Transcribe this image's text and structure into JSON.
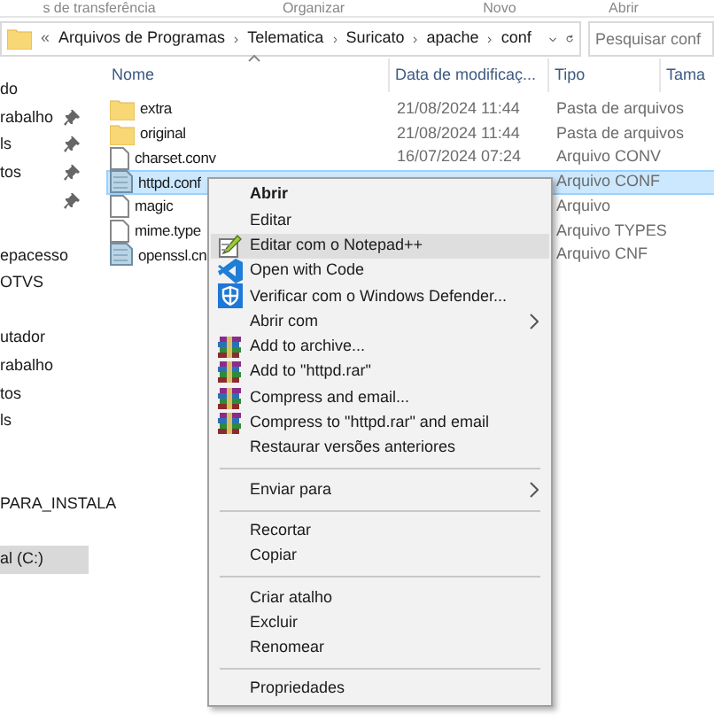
{
  "ribbon_groups": [
    "s de transferência",
    "Organizar",
    "Novo",
    "Abrir"
  ],
  "address_bar": {
    "overflow": "«",
    "crumbs": [
      "Arquivos de Programas",
      "Telematica",
      "Suricato",
      "apache",
      "conf"
    ]
  },
  "search": {
    "placeholder": "Pesquisar conf"
  },
  "sidebar": {
    "items": [
      {
        "label": "do",
        "pinned": false,
        "selected": false
      },
      {
        "label": "rabalho",
        "pinned": true,
        "selected": false
      },
      {
        "label": "ls",
        "pinned": true,
        "selected": false
      },
      {
        "label": "tos",
        "pinned": true,
        "selected": false
      },
      {
        "pinned": true
      },
      {
        "pinned": false
      },
      {
        "label": "epacesso",
        "pinned": false,
        "selected": false
      },
      {
        "label": "OTVS",
        "pinned": false,
        "selected": false
      },
      {
        "pinned": false
      },
      {
        "label": "utador",
        "pinned": false,
        "selected": false
      },
      {
        "label": "rabalho",
        "pinned": false,
        "selected": false
      },
      {
        "label": "tos",
        "pinned": false,
        "selected": false
      },
      {
        "label": "ls",
        "pinned": false,
        "selected": false
      },
      {
        "pinned": false
      },
      {
        "pinned": false
      },
      {
        "label": "PARA_INSTALA",
        "pinned": false,
        "selected": false
      },
      {
        "pinned": false
      },
      {
        "label": "al (C:)",
        "pinned": false,
        "selected": true
      }
    ]
  },
  "table": {
    "columns": [
      "Nome",
      "Data de modificaç...",
      "Tipo",
      "Tama"
    ],
    "rows": [
      {
        "kind": "folder",
        "name": "extra",
        "date": "21/08/2024 11:44",
        "type": "Pasta de arquivos",
        "selected": false
      },
      {
        "kind": "folder",
        "name": "original",
        "date": "21/08/2024 11:44",
        "type": "Pasta de arquivos",
        "selected": false
      },
      {
        "kind": "file",
        "name": "charset.conv",
        "date": "16/07/2024 07:24",
        "type": "Arquivo CONV",
        "selected": false
      },
      {
        "kind": "conf",
        "name": "httpd.conf",
        "type": "Arquivo CONF",
        "selected": true
      },
      {
        "kind": "file",
        "name": "magic",
        "type": "Arquivo",
        "selected": false
      },
      {
        "kind": "file",
        "name": "mime.type",
        "type": "Arquivo TYPES",
        "selected": false
      },
      {
        "kind": "conf",
        "name": "openssl.cn",
        "type": "Arquivo CNF",
        "selected": false
      }
    ]
  },
  "context_menu": [
    {
      "kind": "plain",
      "label": "Abrir",
      "default": true,
      "selected": false,
      "submenu": false
    },
    {
      "kind": "plain",
      "label": "Editar",
      "default": false,
      "selected": false,
      "submenu": false
    },
    {
      "kind": "notepad",
      "label": "Editar com o Notepad++",
      "default": false,
      "selected": true,
      "submenu": false
    },
    {
      "kind": "code",
      "label": "Open with Code",
      "default": false,
      "selected": false,
      "submenu": false
    },
    {
      "kind": "shield",
      "label": "Verificar com o Windows Defender...",
      "default": false,
      "selected": false,
      "submenu": false
    },
    {
      "kind": "plain",
      "label": "Abrir com",
      "default": false,
      "selected": false,
      "submenu": true
    },
    {
      "kind": "archive",
      "label": "Add to archive...",
      "default": false,
      "selected": false,
      "submenu": false
    },
    {
      "kind": "archive",
      "label": "Add to \"httpd.rar\"",
      "default": false,
      "selected": false,
      "submenu": false
    },
    {
      "kind": "archive",
      "label": "Compress and email...",
      "default": false,
      "selected": false,
      "submenu": false
    },
    {
      "kind": "archive",
      "label": "Compress to \"httpd.rar\" and email",
      "default": false,
      "selected": false,
      "submenu": false
    },
    {
      "kind": "plain",
      "label": "Restaurar versões anteriores",
      "default": false,
      "selected": false,
      "submenu": false
    },
    {
      "kind": "separator"
    },
    {
      "kind": "plain",
      "label": "Enviar para",
      "default": false,
      "selected": false,
      "submenu": true
    },
    {
      "kind": "separator"
    },
    {
      "kind": "plain",
      "label": "Recortar",
      "default": false,
      "selected": false,
      "submenu": false
    },
    {
      "kind": "plain",
      "label": "Copiar",
      "default": false,
      "selected": false,
      "submenu": false
    },
    {
      "kind": "separator"
    },
    {
      "kind": "plain",
      "label": "Criar atalho",
      "default": false,
      "selected": false,
      "submenu": false
    },
    {
      "kind": "plain",
      "label": "Excluir",
      "default": false,
      "selected": false,
      "submenu": false
    },
    {
      "kind": "plain",
      "label": "Renomear",
      "default": false,
      "selected": false,
      "submenu": false
    },
    {
      "kind": "separator"
    },
    {
      "kind": "plain",
      "label": "Propriedades",
      "default": false,
      "selected": false,
      "submenu": false
    }
  ]
}
